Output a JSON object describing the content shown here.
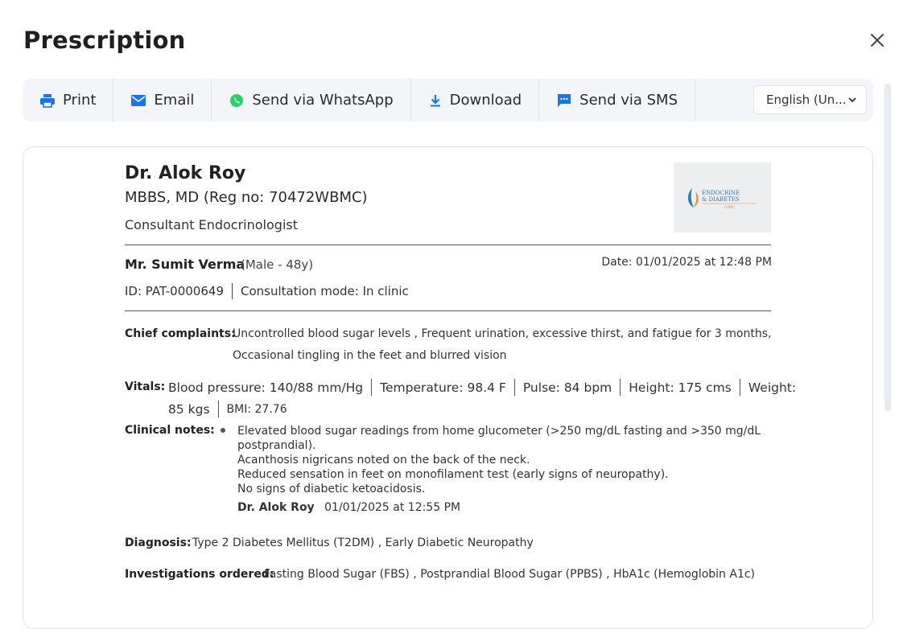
{
  "modal": {
    "title": "Prescription"
  },
  "toolbar": {
    "print": "Print",
    "email": "Email",
    "whatsapp": "Send via WhatsApp",
    "download": "Download",
    "sms": "Send via SMS",
    "language": "English (Un..."
  },
  "doctor": {
    "name": "Dr. Alok Roy",
    "qualification": "MBBS, MD (Reg no: 70472WBMC)",
    "designation": "Consultant Endocrinologist"
  },
  "clinic_logo": {
    "line1": "ENDOCRINE",
    "line2": "& DIABETES",
    "line3": "CLINIC"
  },
  "patient": {
    "name": "Mr. Sumit Verma",
    "meta": "(Male - 48y)",
    "date": "Date: 01/01/2025 at 12:48 PM",
    "id": "ID: PAT-0000649",
    "mode": "Consultation mode: In clinic"
  },
  "chief_complaints": {
    "label": "Chief complaints:",
    "line1": "Uncontrolled blood sugar levels ,  Frequent urination, excessive thirst, and fatigue for 3 months,",
    "line2": "Occasional tingling in the feet and blurred vision"
  },
  "vitals": {
    "label": "Vitals:",
    "bp": "Blood pressure: 140/88 mm/Hg",
    "temperature": "Temperature: 98.4 F",
    "pulse": "Pulse: 84 bpm",
    "height": "Height: 175 cms",
    "weight_label": "Weight:",
    "weight_value": "85 kgs",
    "bmi": "BMI: 27.76"
  },
  "clinical_notes": {
    "label": "Clinical notes:",
    "lines": [
      "Elevated blood sugar readings from home glucometer (>250 mg/dL fasting and >350 mg/dL",
      "postprandial).",
      "Acanthosis nigricans noted on the back of the neck.",
      "Reduced sensation in feet on monofilament test (early signs of neuropathy).",
      "No signs of diabetic ketoacidosis."
    ],
    "signed_by": "Dr. Alok Roy",
    "signed_at": "01/01/2025 at 12:55 PM"
  },
  "diagnosis": {
    "label": "Diagnosis:",
    "value": "Type 2 Diabetes Mellitus (T2DM) ,  Early Diabetic Neuropathy"
  },
  "investigations": {
    "label": "Investigations ordered:",
    "value": "Fasting Blood Sugar (FBS) ,  Postprandial Blood Sugar (PPBS) ,  HbA1c (Hemoglobin A1c)"
  },
  "colors": {
    "toolbar_bg": "#f3f5f8",
    "icon_blue": "#1a73e8",
    "whatsapp_green": "#25d366"
  }
}
